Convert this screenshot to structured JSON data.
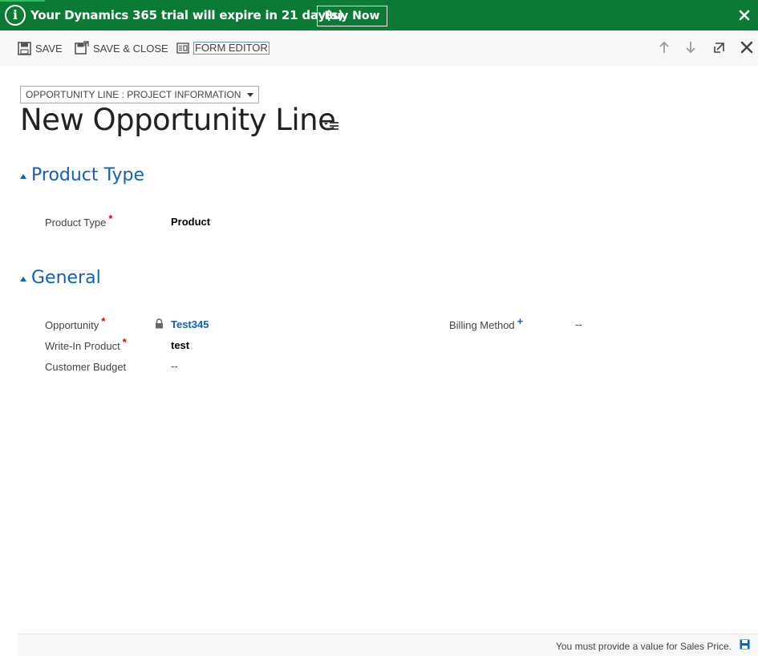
{
  "banner": {
    "info_glyph": "i",
    "message": "Your Dynamics 365 trial will expire in 21 day(s)",
    "buy_label": "Buy Now",
    "close_icon": "close-icon",
    "color": "#0b7a35"
  },
  "toolbar": {
    "save_label": "SAVE",
    "save_close_label": "SAVE & CLOSE",
    "form_editor_label": "FORM EDITOR",
    "icons": [
      "save-icon",
      "save-close-icon",
      "form-editor-icon",
      "arrow-up-icon",
      "arrow-down-icon",
      "expand-icon",
      "close-icon"
    ]
  },
  "form": {
    "selector_label": "OPPORTUNITY LINE : PROJECT INFORMATION",
    "title": "New Opportunity Line"
  },
  "sections": {
    "product_type": {
      "title": "Product Type",
      "field_label": "Product Type",
      "field_value": "Product"
    },
    "general": {
      "title": "General",
      "opportunity_label": "Opportunity",
      "opportunity_value": "Test345",
      "write_in_label": "Write-In Product",
      "write_in_value": "test",
      "budget_label": "Customer Budget",
      "budget_value": "--",
      "billing_label": "Billing Method",
      "billing_value": "--"
    }
  },
  "markers": {
    "required": "*",
    "recommended": "+"
  },
  "footer": {
    "message": "You must provide a value for Sales Price."
  },
  "colors": {
    "accent": "#1160b7",
    "required": "#e00000"
  }
}
